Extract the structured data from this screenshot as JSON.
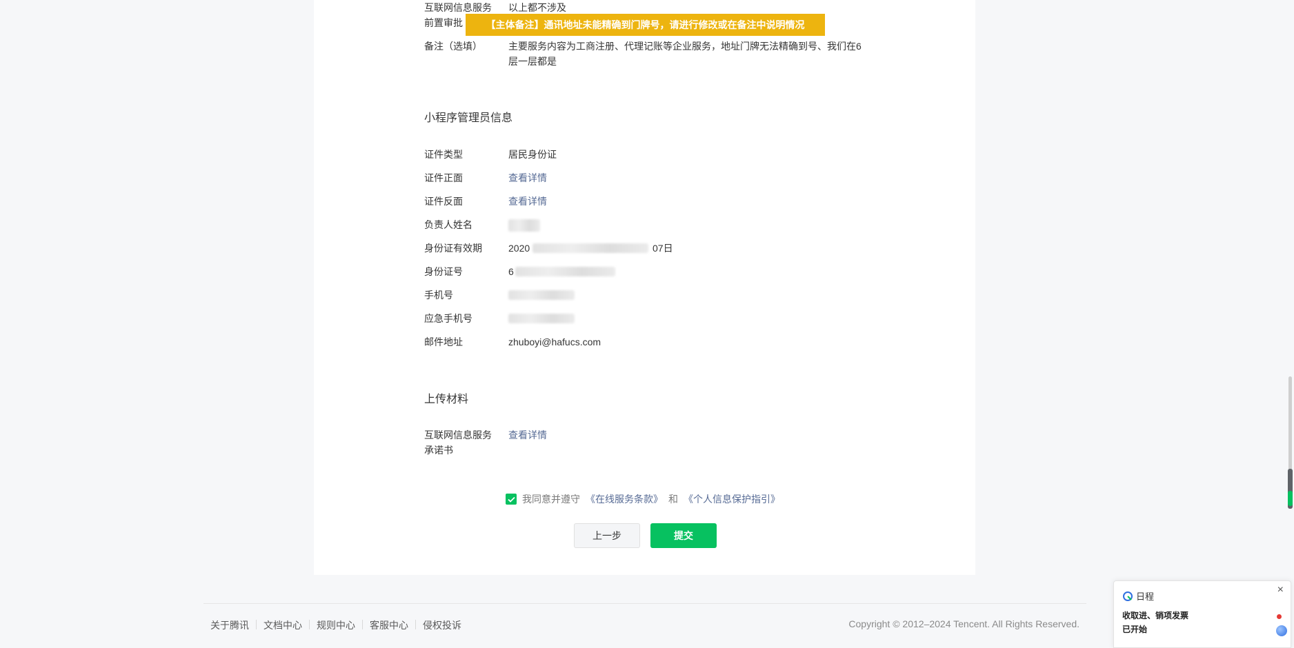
{
  "banner": "【主体备注】通讯地址未能精确到门牌号，请进行修改或在备注中说明情况",
  "top_rows": {
    "internet_service_label": "互联网信息服务",
    "internet_service_value": "以上都不涉及",
    "pre_approval_label_partial": "前置审批",
    "remark_label": "备注（选填）",
    "remark_value_line1": "主要服务内容为工商注册、代理记账等企业服务，地址门牌无法精确到号、我们在6",
    "remark_value_line2": "层一层都是"
  },
  "admin_section": {
    "title": "小程序管理员信息",
    "fields": {
      "id_type_label": "证件类型",
      "id_type_value": "居民身份证",
      "id_front_label": "证件正面",
      "id_front_link": "查看详情",
      "id_back_label": "证件反面",
      "id_back_link": "查看详情",
      "name_label": "负责人姓名",
      "id_validity_label": "身份证有效期",
      "id_validity_prefix": "2020",
      "id_validity_suffix": "07日",
      "id_number_label": "身份证号",
      "id_number_prefix": "6",
      "phone_label": "手机号",
      "emergency_phone_label": "应急手机号",
      "email_label": "邮件地址",
      "email_value": "zhuboyi@hafucs.com"
    }
  },
  "upload_section": {
    "title": "上传材料",
    "commitment_label_line1": "互联网信息服务",
    "commitment_label_line2": "承诺书",
    "commitment_link": "查看详情"
  },
  "agreement": {
    "checked": true,
    "prefix": "我同意并遵守",
    "terms_link": "《在线服务条款》",
    "and": "和",
    "privacy_link": "《个人信息保护指引》"
  },
  "buttons": {
    "prev": "上一步",
    "submit": "提交"
  },
  "footer": {
    "links": [
      "关于腾讯",
      "文档中心",
      "规则中心",
      "客服中心",
      "侵权投诉"
    ],
    "copyright": "Copyright © 2012–2024 Tencent. All Rights Reserved."
  },
  "notification": {
    "app_name": "日程",
    "line1": "收取进、销项发票",
    "line2": "已开始",
    "close_glyph": "×"
  },
  "colors": {
    "accent_green": "#07c160",
    "banner_yellow": "#edb40f",
    "link_blue": "#576b95"
  }
}
